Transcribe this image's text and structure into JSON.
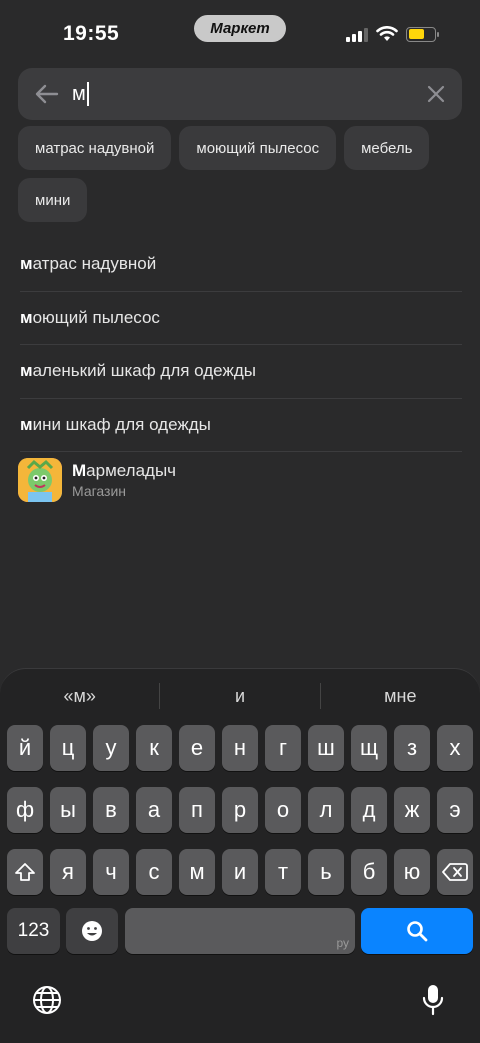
{
  "status": {
    "time": "19:55",
    "island_label": "Маркет"
  },
  "search": {
    "query": "м"
  },
  "chips": [
    "матрас надувной",
    "моющий пылесос",
    "мебель",
    "мини"
  ],
  "suggestions": [
    {
      "bold": "м",
      "rest": "атрас надувной"
    },
    {
      "bold": "м",
      "rest": "оющий пылесос"
    },
    {
      "bold": "м",
      "rest": "аленький шкаф для одежды"
    },
    {
      "bold": "м",
      "rest": "ини шкаф для одежды"
    }
  ],
  "shop": {
    "name_bold": "М",
    "name_rest": "армеладыч",
    "subtitle": "Магазин"
  },
  "keyboard": {
    "predictions": [
      "«м»",
      "и",
      "мне"
    ],
    "row1": [
      "й",
      "ц",
      "у",
      "к",
      "е",
      "н",
      "г",
      "ш",
      "щ",
      "з",
      "х"
    ],
    "row2": [
      "ф",
      "ы",
      "в",
      "а",
      "п",
      "р",
      "о",
      "л",
      "д",
      "ж",
      "э"
    ],
    "row3": [
      "я",
      "ч",
      "с",
      "м",
      "и",
      "т",
      "ь",
      "б",
      "ю"
    ],
    "numbers_label": "123",
    "space_lang": "ру"
  },
  "colors": {
    "accent": "#0a84ff",
    "battery": "#ffd60a"
  }
}
